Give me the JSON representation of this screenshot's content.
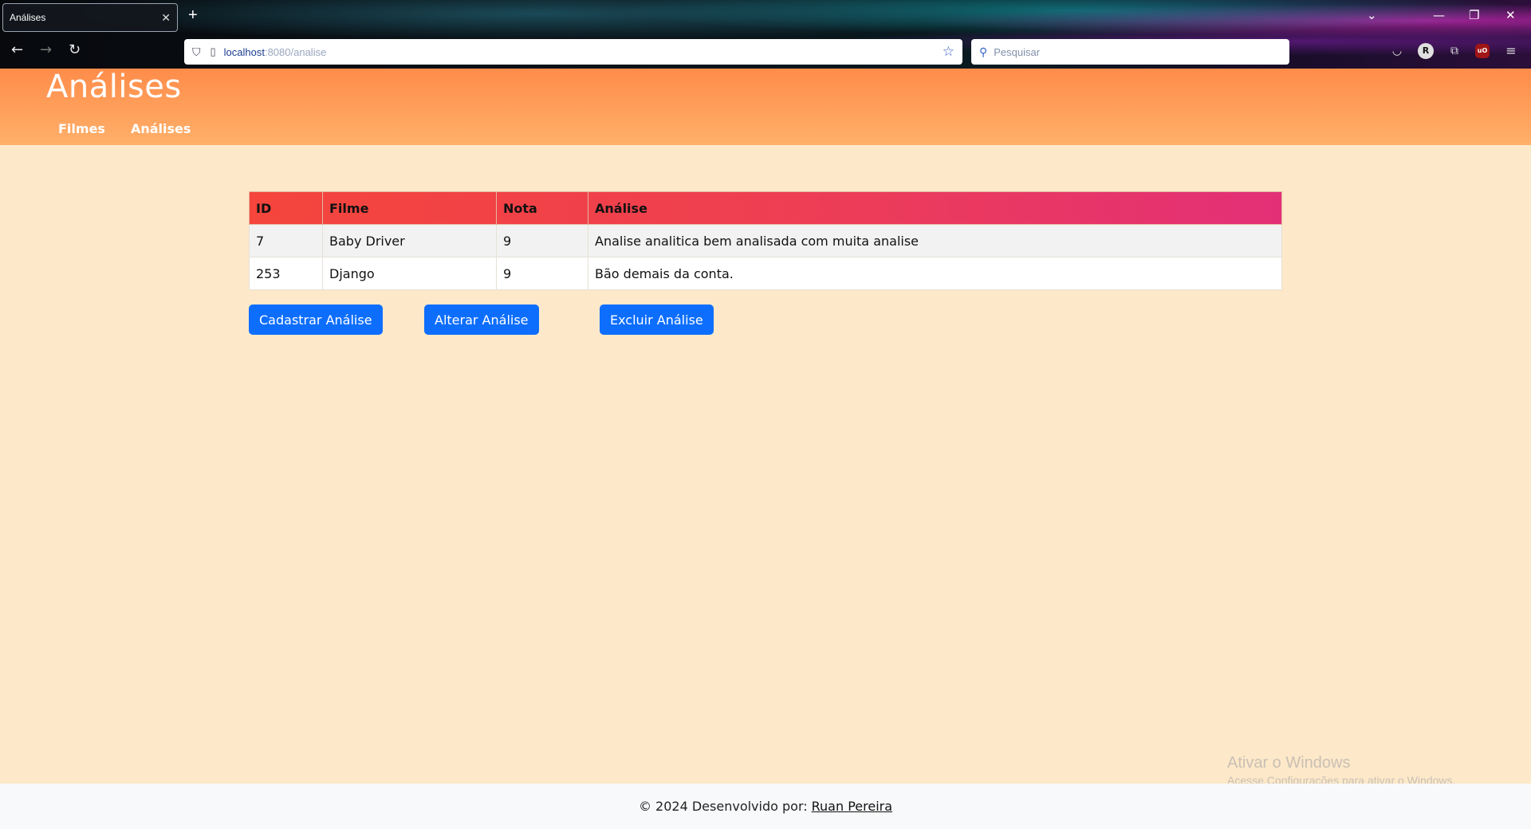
{
  "browser": {
    "tab_title": "Análises",
    "tab_close": "✕",
    "new_tab": "+",
    "url_host": "localhost",
    "url_path": ":8080/analise",
    "search_placeholder": "Pesquisar",
    "window_controls": {
      "dropdown": "⌄",
      "minimize": "—",
      "restore": "❐",
      "close": "✕"
    },
    "nav": {
      "back": "←",
      "forward": "→",
      "reload": "↻"
    },
    "toolbar_icons": [
      "pocket-icon",
      "profile-icon",
      "extensions-icon",
      "ublock-icon",
      "menu-icon"
    ],
    "profile_letter": "R"
  },
  "header": {
    "title": "Análises",
    "nav": [
      "Filmes",
      "Análises"
    ]
  },
  "table": {
    "headers": [
      "ID",
      "Filme",
      "Nota",
      "Análise"
    ],
    "rows": [
      [
        "7",
        "Baby Driver",
        "9",
        "Analise analitica bem analisada com muita analise"
      ],
      [
        "253",
        "Django",
        "9",
        "Bão demais da conta."
      ]
    ]
  },
  "actions": {
    "create": "Cadastrar Análise",
    "edit": "Alterar Análise",
    "delete": "Excluir Análise"
  },
  "watermark": {
    "line1": "Ativar o Windows",
    "line2": "Acesse Configurações para ativar o Windows."
  },
  "footer": {
    "text": "© 2024 Desenvolvido por:",
    "author": "Ruan Pereira"
  },
  "colors": {
    "header_gradient_top": "#ff8c4a",
    "header_gradient_bottom": "#ffb06a",
    "page_background": "#fde9c9",
    "table_header_left": "#f5453c",
    "table_header_right": "#e32f77",
    "button": "#0d6efd",
    "footer_bg": "#f8f9fa"
  }
}
